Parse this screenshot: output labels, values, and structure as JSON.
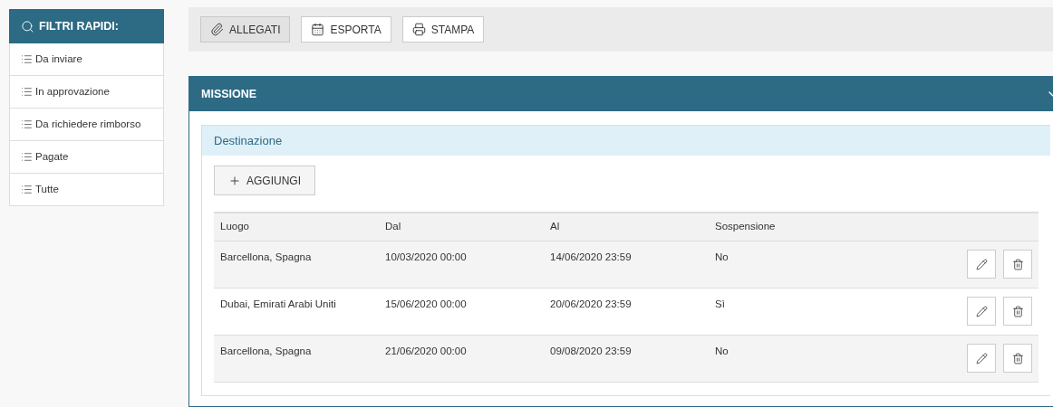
{
  "sidebar": {
    "title": "FILTRI RAPIDI:",
    "items": [
      {
        "label": "Da inviare"
      },
      {
        "label": "In approvazione"
      },
      {
        "label": "Da richiedere rimborso"
      },
      {
        "label": "Pagate"
      },
      {
        "label": "Tutte"
      }
    ]
  },
  "toolbar": [
    {
      "kind": "attach",
      "label": "ALLEGATI",
      "pressed": true
    },
    {
      "kind": "calendar",
      "label": "ESPORTA",
      "pressed": false
    },
    {
      "kind": "print",
      "label": "STAMPA",
      "pressed": false
    }
  ],
  "panel": {
    "title": "MISSIONE",
    "expanded": true,
    "section": {
      "title": "Destinazione",
      "add_button": "AGGIUNGI",
      "table": {
        "columns": [
          "Luogo",
          "Dal",
          "Al",
          "Sospensione"
        ],
        "rows": [
          {
            "cells": [
              "Barcellona, Spagna",
              "10/03/2020 00:00",
              "14/06/2020 23:59",
              "No"
            ]
          },
          {
            "cells": [
              "Dubai, Emirati Arabi Uniti",
              "15/06/2020 00:00",
              "20/06/2020 23:59",
              "Sì"
            ]
          },
          {
            "cells": [
              "Barcellona, Spagna",
              "21/06/2020 00:00",
              "09/08/2020 23:59",
              "No"
            ]
          }
        ]
      }
    }
  }
}
